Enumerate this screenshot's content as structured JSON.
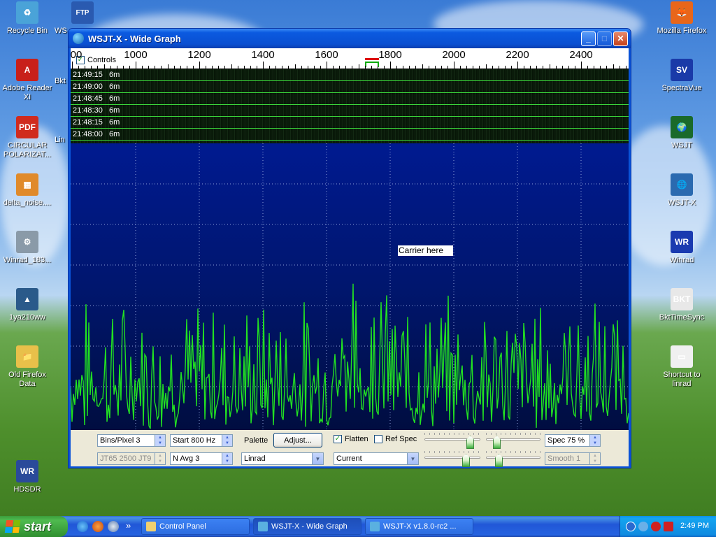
{
  "desktop": {
    "icons_left": [
      {
        "label": "Recycle Bin",
        "glyph": "♻",
        "color": "#4aa3d8"
      },
      {
        "label": "Adobe Reader XI",
        "glyph": "A",
        "color": "#c8201a"
      },
      {
        "label": "CIRCULAR POLARIZAT...",
        "glyph": "PDF",
        "color": "#d02b1e"
      },
      {
        "label": "delta_noise....",
        "glyph": "▦",
        "color": "#e08a2a"
      },
      {
        "label": "Winrad_183...",
        "glyph": "⚙",
        "color": "#8a9aa8"
      },
      {
        "label": "1ya210ww",
        "glyph": "▲",
        "color": "#2a5a8a"
      },
      {
        "label": "Old Firefox Data",
        "glyph": "📁",
        "color": "#e8c04a"
      },
      {
        "label": "HDSDR",
        "glyph": "WR",
        "color": "#2a4a9a"
      }
    ],
    "icons_col2": [
      {
        "label": "WS",
        "glyph": "FTP",
        "color": "#2a5ab0"
      },
      {
        "label": "Bkt",
        "glyph": "",
        "color": "#1e4fb9"
      },
      {
        "label": "Lin",
        "glyph": "",
        "color": "#1e4fb9"
      }
    ],
    "icons_right": [
      {
        "label": "Mozilla Firefox",
        "glyph": "🦊",
        "color": "#e8661a"
      },
      {
        "label": "SpectraVue",
        "glyph": "SV",
        "color": "#1a3aa8"
      },
      {
        "label": "WSJT",
        "glyph": "🌍",
        "color": "#1a6a2a"
      },
      {
        "label": "WSJT-X",
        "glyph": "🌐",
        "color": "#2a6ab0"
      },
      {
        "label": "Winrad",
        "glyph": "WR",
        "color": "#1a3ab0"
      },
      {
        "label": "BktTimeSync",
        "glyph": "BKT",
        "color": "#e8e8e8"
      },
      {
        "label": "Shortcut to linrad",
        "glyph": "▭",
        "color": "#f0f0f0"
      }
    ]
  },
  "window": {
    "title": "WSJT-X - Wide Graph",
    "min_glyph": "_",
    "max_glyph": "□",
    "close_glyph": "✕",
    "controls_label": "Controls",
    "controls_checked": "✓",
    "freq_scale": {
      "ticks": [
        "00",
        "1000",
        "1200",
        "1400",
        "1600",
        "1800",
        "2000",
        "2200",
        "2400"
      ]
    },
    "waterfall_rows": [
      "21:49:15   6m",
      "21:49:00   6m",
      "21:48:45   6m",
      "21:48:30   6m",
      "21:48:15   6m",
      "21:48:00   6m"
    ],
    "carrier_label": "Carrier here",
    "spectrum_color": "#22e022",
    "controls": {
      "bins_per_pixel": "Bins/Pixel  3",
      "start": "Start 800 Hz",
      "mode": "JT65  2500  JT9",
      "n_avg": "N Avg 3",
      "palette_label": "Palette",
      "adjust_button": "Adjust...",
      "palette_select": "Linrad",
      "flatten_label": "Flatten",
      "flatten_checked": "✓",
      "ref_spec_label": "Ref Spec",
      "spectrum_select": "Current",
      "spec_pct": "Spec 75 %",
      "smooth": "Smooth  1"
    }
  },
  "taskbar": {
    "start_label": "start",
    "chevron": "»",
    "tasks": [
      {
        "label": "Control Panel",
        "color": "#f0d070"
      },
      {
        "label": "WSJT-X - Wide Graph",
        "color": "#5ab0e0"
      },
      {
        "label": "WSJT-X   v1.8.0-rc2   ...",
        "color": "#5ab0e0"
      }
    ],
    "clock": "2:49 PM"
  }
}
